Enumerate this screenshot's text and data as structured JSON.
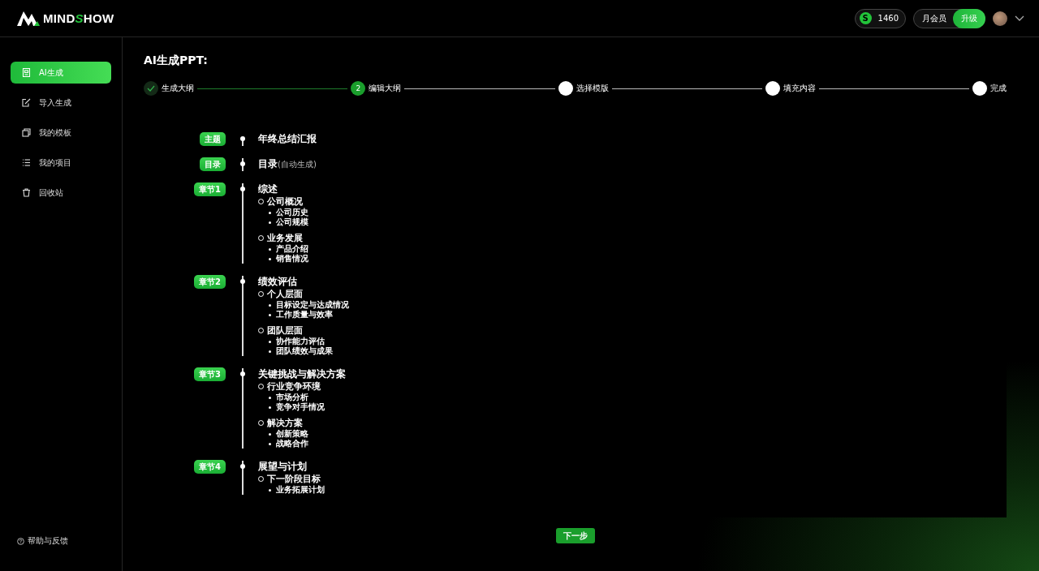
{
  "header": {
    "logo": {
      "before": "MIND",
      "accent": "S",
      "after": "HOW"
    },
    "coins": {
      "symbol": "S",
      "amount": "1460"
    },
    "membership": {
      "label": "月会员",
      "action": "升级"
    }
  },
  "sidebar": {
    "items": [
      {
        "label": "AI生成",
        "selected": true
      },
      {
        "label": "导入生成",
        "selected": false
      },
      {
        "label": "我的模板",
        "selected": false
      },
      {
        "label": "我的项目",
        "selected": false
      },
      {
        "label": "回收站",
        "selected": false
      }
    ],
    "help": "帮助与反馈"
  },
  "page_title": "AI生成PPT:",
  "steps": [
    {
      "label": "生成大纲",
      "completed": true,
      "selected": false
    },
    {
      "label": "编辑大纲",
      "completed": false,
      "selected": true,
      "number": "2"
    },
    {
      "label": "选择模版",
      "completed": false,
      "selected": false
    },
    {
      "label": "填充内容",
      "completed": false,
      "selected": false
    },
    {
      "label": "完成",
      "completed": false,
      "selected": false
    }
  ],
  "outline": [
    {
      "tag": "主题",
      "title": "年终总结汇报"
    },
    {
      "tag": "目录",
      "title": "目录",
      "note": "(自动生成)"
    },
    {
      "tag": "章节1",
      "title": "综述",
      "children": [
        {
          "title": "公司概况",
          "children": [
            "公司历史",
            "公司规模"
          ]
        },
        {
          "title": "业务发展",
          "children": [
            "产品介绍",
            "销售情况"
          ]
        }
      ]
    },
    {
      "tag": "章节2",
      "title": "绩效评估",
      "children": [
        {
          "title": "个人层面",
          "children": [
            "目标设定与达成情况",
            "工作质量与效率"
          ]
        },
        {
          "title": "团队层面",
          "children": [
            "协作能力评估",
            "团队绩效与成果"
          ]
        }
      ]
    },
    {
      "tag": "章节3",
      "title": "关键挑战与解决方案",
      "children": [
        {
          "title": "行业竞争环境",
          "children": [
            "市场分析",
            "竞争对手情况"
          ]
        },
        {
          "title": "解决方案",
          "children": [
            "创新策略",
            "战略合作"
          ]
        }
      ]
    },
    {
      "tag": "章节4",
      "title": "展望与计划",
      "children": [
        {
          "title": "下一阶段目标",
          "children": [
            "业务拓展计划"
          ]
        }
      ]
    }
  ],
  "next_button": "下一步"
}
